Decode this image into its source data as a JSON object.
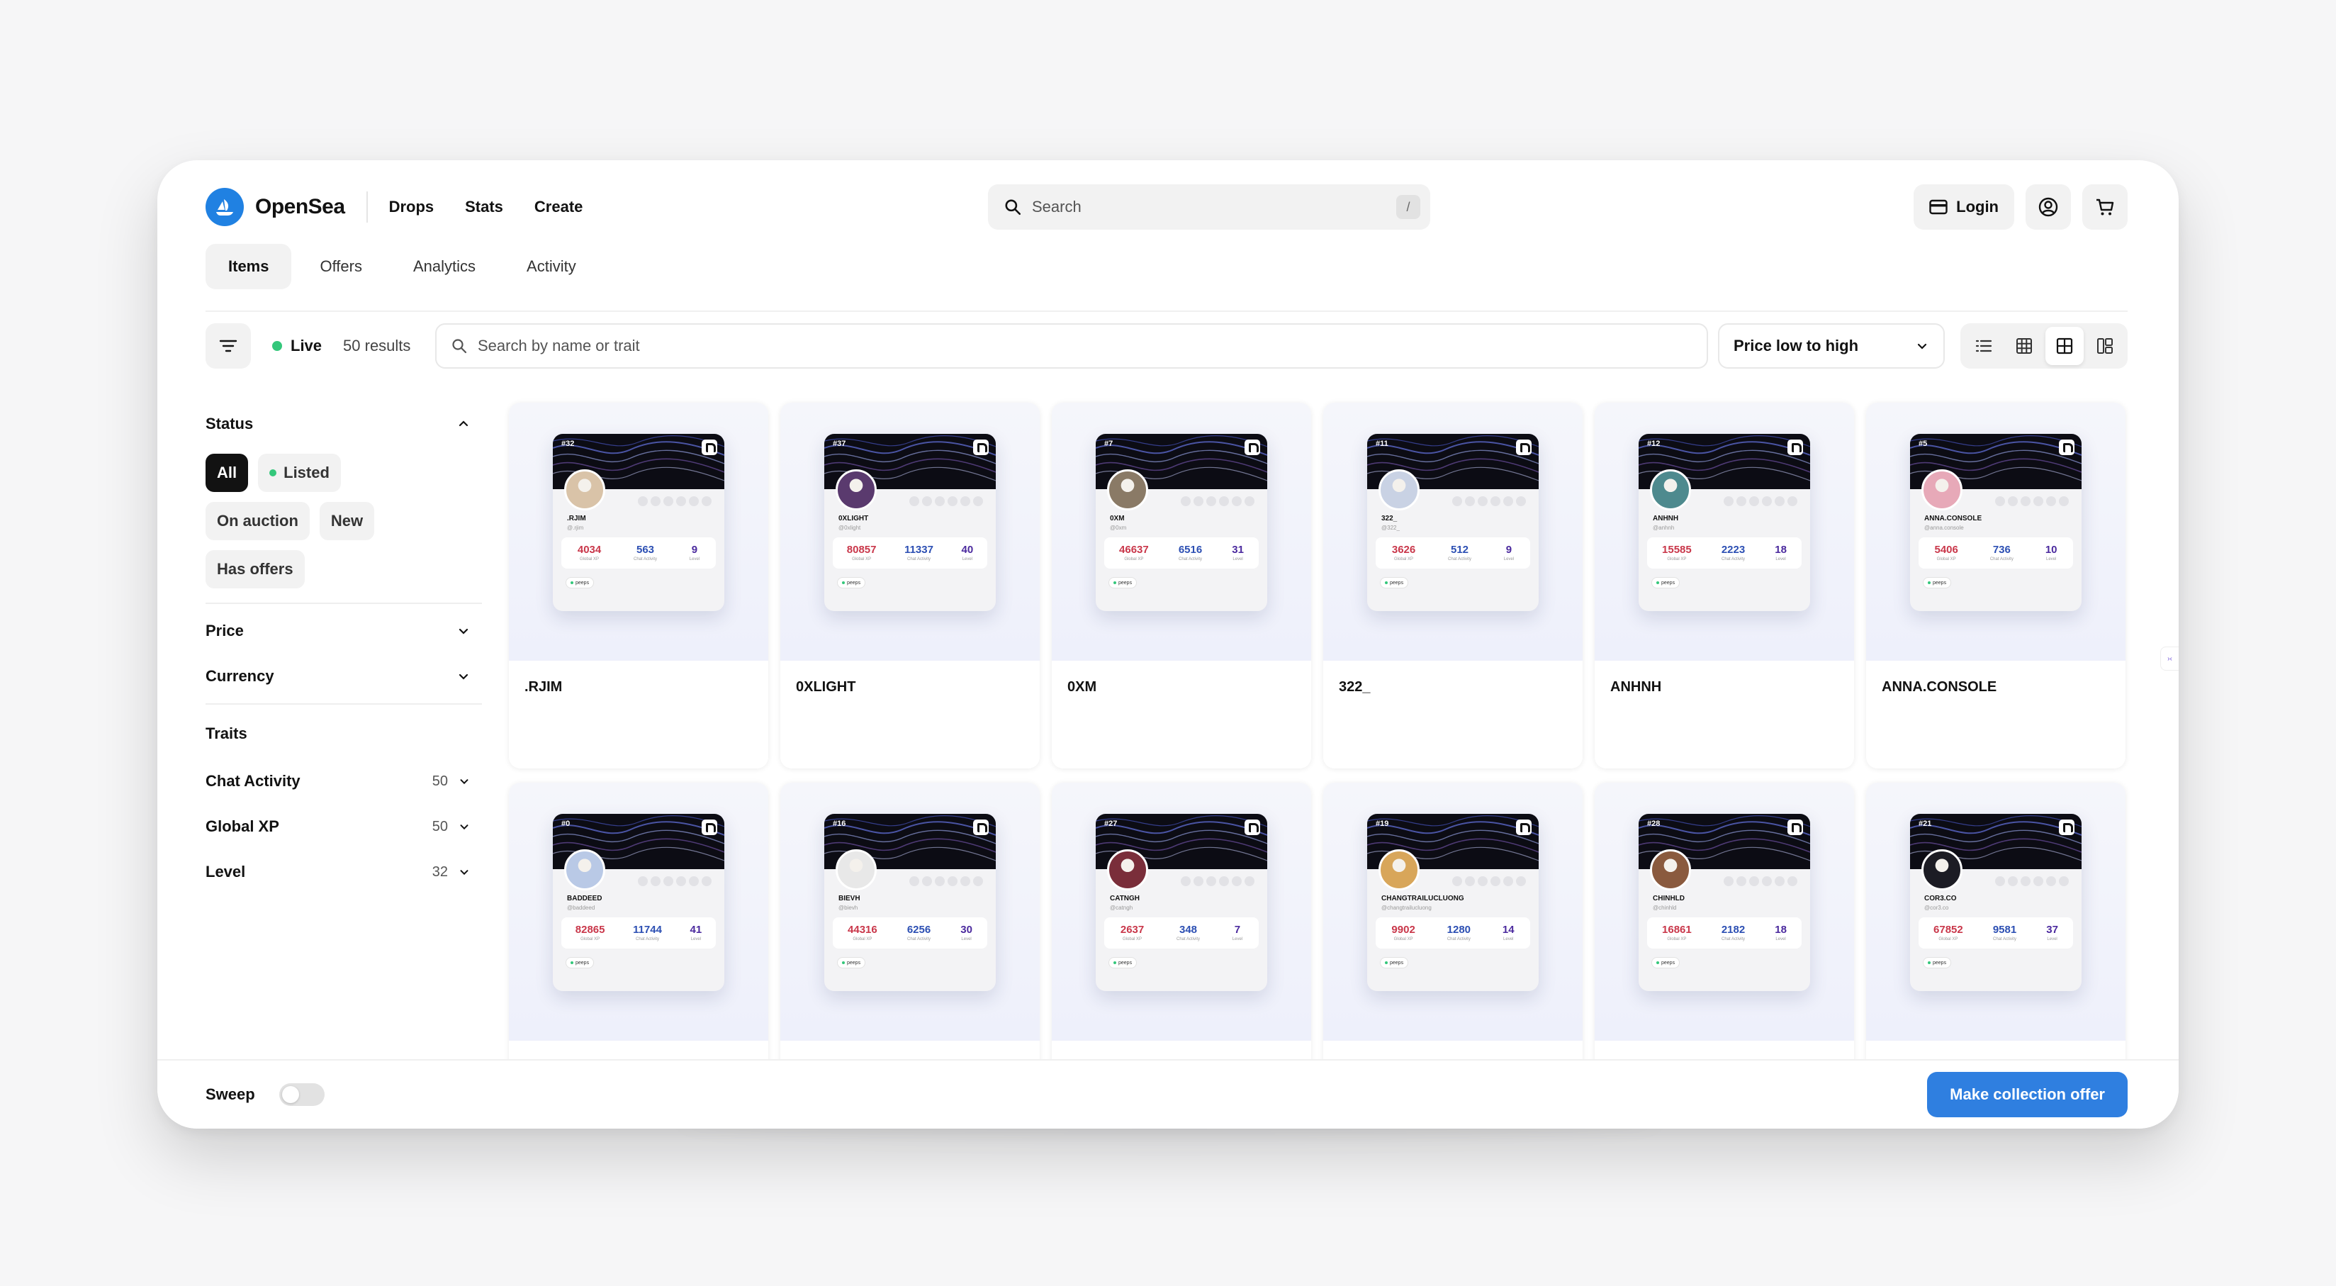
{
  "header": {
    "brand": "OpenSea",
    "nav": [
      "Drops",
      "Stats",
      "Create"
    ],
    "search_placeholder": "Search",
    "search_shortcut": "/",
    "login_label": "Login"
  },
  "tabs": [
    "Items",
    "Offers",
    "Analytics",
    "Activity"
  ],
  "toolbar": {
    "live_label": "Live",
    "results": "50 results",
    "trait_search_placeholder": "Search by name or trait",
    "sort_label": "Price low to high"
  },
  "sidebar": {
    "status_label": "Status",
    "status_chips": [
      "All",
      "Listed",
      "On auction",
      "New",
      "Has offers"
    ],
    "price_label": "Price",
    "currency_label": "Currency",
    "traits_label": "Traits",
    "traits": [
      {
        "name": "Chat Activity",
        "count": "50"
      },
      {
        "name": "Global XP",
        "count": "50"
      },
      {
        "name": "Level",
        "count": "32"
      }
    ]
  },
  "badge_labels": {
    "xp": "Global XP",
    "chat": "Chat Activity",
    "level": "Level",
    "tag": "peeps"
  },
  "items": [
    {
      "name": ".RJIM",
      "id": "#32",
      "user": ".RJIM",
      "handle": "@.rjim",
      "xp": "4034",
      "chat": "563",
      "level": "9",
      "avatar": "#d9c3a8"
    },
    {
      "name": "0XLIGHT",
      "id": "#37",
      "user": "0XLIGHT",
      "handle": "@0xlight",
      "xp": "80857",
      "chat": "11337",
      "level": "40",
      "avatar": "#5a3a6e"
    },
    {
      "name": "0XM",
      "id": "#7",
      "user": "0XM",
      "handle": "@0xm",
      "xp": "46637",
      "chat": "6516",
      "level": "31",
      "avatar": "#8a7a66"
    },
    {
      "name": "322_",
      "id": "#11",
      "user": "322_",
      "handle": "@322_",
      "xp": "3626",
      "chat": "512",
      "level": "9",
      "avatar": "#c9d2e4"
    },
    {
      "name": "ANHNH",
      "id": "#12",
      "user": "ANHNH",
      "handle": "@anhnh",
      "xp": "15585",
      "chat": "2223",
      "level": "18",
      "avatar": "#4e8a8e"
    },
    {
      "name": "ANNA.CONSOLE",
      "id": "#5",
      "user": "ANNA.CONSOLE",
      "handle": "@anna.console",
      "xp": "5406",
      "chat": "736",
      "level": "10",
      "avatar": "#e7a9b8"
    },
    {
      "name": "BADDEED",
      "id": "#0",
      "user": "BADDEED",
      "handle": "@baddeed",
      "xp": "82865",
      "chat": "11744",
      "level": "41",
      "avatar": "#b9c9e6"
    },
    {
      "name": "BIEVH",
      "id": "#16",
      "user": "BIEVH",
      "handle": "@bievh",
      "xp": "44316",
      "chat": "6256",
      "level": "30",
      "avatar": "#e8e8e8"
    },
    {
      "name": "CATNGH",
      "id": "#27",
      "user": "CATNGH",
      "handle": "@catngh",
      "xp": "2637",
      "chat": "348",
      "level": "7",
      "avatar": "#7a2e3a"
    },
    {
      "name": "CHANGTRAILUCLUONG",
      "id": "#19",
      "user": "CHANGTRAILUCLUONG",
      "handle": "@changtrailucluong",
      "xp": "9902",
      "chat": "1280",
      "level": "14",
      "avatar": "#d8a65a"
    },
    {
      "name": "CHINHLD",
      "id": "#28",
      "user": "CHINHLD",
      "handle": "@chinhld",
      "xp": "16861",
      "chat": "2182",
      "level": "18",
      "avatar": "#8a5a3e"
    },
    {
      "name": "COR3.CO",
      "id": "#21",
      "user": "COR3.CO",
      "handle": "@cor3.co",
      "xp": "67852",
      "chat": "9581",
      "level": "37",
      "avatar": "#1c1c24"
    }
  ],
  "bottom": {
    "sweep_label": "Sweep",
    "offer_button": "Make collection offer"
  },
  "colors": {
    "accent": "#2081e2",
    "offer_button": "#2f7fe0",
    "live_dot": "#34c77b"
  }
}
